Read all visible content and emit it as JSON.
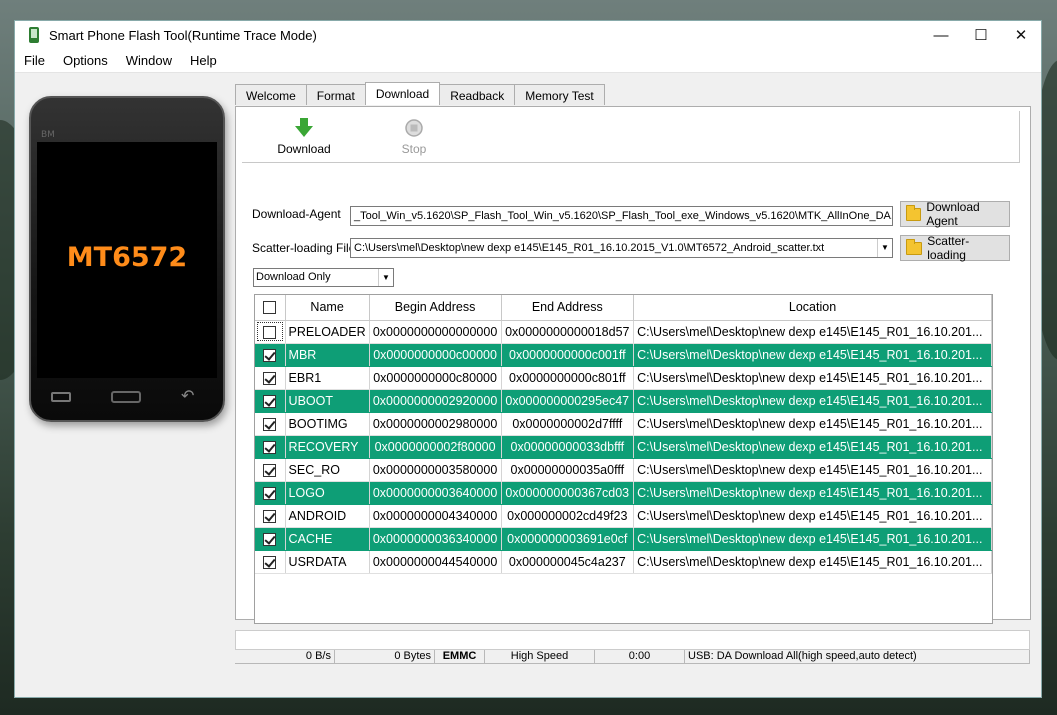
{
  "window": {
    "title": "Smart Phone Flash Tool(Runtime Trace Mode)",
    "controls": {
      "minimize": "—",
      "maximize": "☐",
      "close": "✕"
    }
  },
  "menu": [
    "File",
    "Options",
    "Window",
    "Help"
  ],
  "phone": {
    "brand": "BM",
    "model": "MT6572"
  },
  "tabs": [
    "Welcome",
    "Format",
    "Download",
    "Readback",
    "Memory Test"
  ],
  "active_tab": "Download",
  "toolbar": {
    "download_label": "Download",
    "stop_label": "Stop"
  },
  "download_agent": {
    "label": "Download-Agent",
    "path": "_Tool_Win_v5.1620\\SP_Flash_Tool_Win_v5.1620\\SP_Flash_Tool_exe_Windows_v5.1620\\MTK_AllInOne_DA.bin",
    "button": "Download Agent"
  },
  "scatter": {
    "label": "Scatter-loading File",
    "path": "C:\\Users\\mel\\Desktop\\new dexp e145\\E145_R01_16.10.2015_V1.0\\MT6572_Android_scatter.txt",
    "button": "Scatter-loading"
  },
  "mode": "Download Only",
  "table": {
    "headers": [
      "Name",
      "Begin Address",
      "End Address",
      "Location"
    ],
    "rows": [
      {
        "checked": false,
        "name": "PRELOADER",
        "begin": "0x0000000000000000",
        "end": "0x0000000000018d57",
        "location": "C:\\Users\\mel\\Desktop\\new dexp e145\\E145_R01_16.10.201..."
      },
      {
        "checked": true,
        "name": "MBR",
        "begin": "0x0000000000c00000",
        "end": "0x0000000000c001ff",
        "location": "C:\\Users\\mel\\Desktop\\new dexp e145\\E145_R01_16.10.201..."
      },
      {
        "checked": true,
        "name": "EBR1",
        "begin": "0x0000000000c80000",
        "end": "0x0000000000c801ff",
        "location": "C:\\Users\\mel\\Desktop\\new dexp e145\\E145_R01_16.10.201..."
      },
      {
        "checked": true,
        "name": "UBOOT",
        "begin": "0x0000000002920000",
        "end": "0x000000000295ec47",
        "location": "C:\\Users\\mel\\Desktop\\new dexp e145\\E145_R01_16.10.201..."
      },
      {
        "checked": true,
        "name": "BOOTIMG",
        "begin": "0x0000000002980000",
        "end": "0x0000000002d7ffff",
        "location": "C:\\Users\\mel\\Desktop\\new dexp e145\\E145_R01_16.10.201..."
      },
      {
        "checked": true,
        "name": "RECOVERY",
        "begin": "0x0000000002f80000",
        "end": "0x00000000033dbfff",
        "location": "C:\\Users\\mel\\Desktop\\new dexp e145\\E145_R01_16.10.201..."
      },
      {
        "checked": true,
        "name": "SEC_RO",
        "begin": "0x0000000003580000",
        "end": "0x00000000035a0fff",
        "location": "C:\\Users\\mel\\Desktop\\new dexp e145\\E145_R01_16.10.201..."
      },
      {
        "checked": true,
        "name": "LOGO",
        "begin": "0x0000000003640000",
        "end": "0x000000000367cd03",
        "location": "C:\\Users\\mel\\Desktop\\new dexp e145\\E145_R01_16.10.201..."
      },
      {
        "checked": true,
        "name": "ANDROID",
        "begin": "0x0000000004340000",
        "end": "0x000000002cd49f23",
        "location": "C:\\Users\\mel\\Desktop\\new dexp e145\\E145_R01_16.10.201..."
      },
      {
        "checked": true,
        "name": "CACHE",
        "begin": "0x0000000036340000",
        "end": "0x000000003691e0cf",
        "location": "C:\\Users\\mel\\Desktop\\new dexp e145\\E145_R01_16.10.201..."
      },
      {
        "checked": true,
        "name": "USRDATA",
        "begin": "0x0000000044540000",
        "end": "0x000000045c4a237",
        "location": "C:\\Users\\mel\\Desktop\\new dexp e145\\E145_R01_16.10.201..."
      }
    ]
  },
  "status": {
    "speed": "0 B/s",
    "bytes": "0 Bytes",
    "storage": "EMMC",
    "usb_mode": "High Speed",
    "time": "0:00",
    "message": "USB: DA Download All(high speed,auto detect)"
  },
  "colors": {
    "row_highlight": "#0e9e76",
    "phone_model": "#ff8c1a",
    "download_arrow": "#3aa635"
  }
}
